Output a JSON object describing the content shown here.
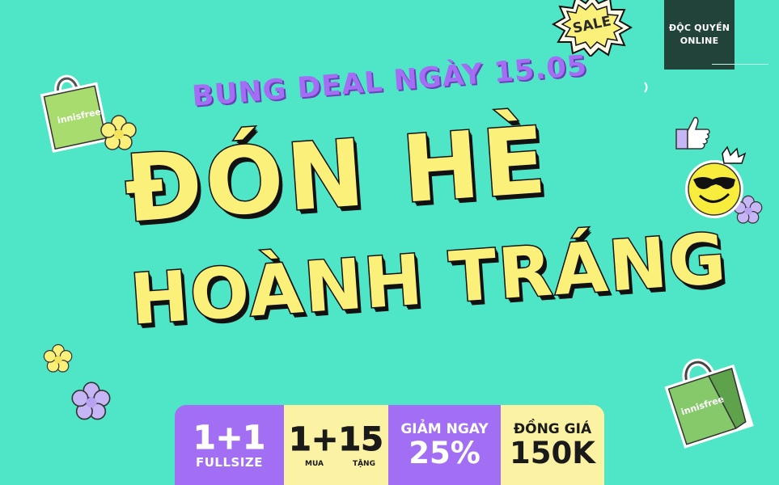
{
  "badge": {
    "line1": "ĐỘC QUYỀN",
    "line2": "ONLINE"
  },
  "subtitle": "BUNG DEAL NGÀY 15.05",
  "title": {
    "line1": "ĐÓN HÈ",
    "line2": "HOÀNH TRÁNG"
  },
  "deals": [
    {
      "big": "1+1",
      "small": "FULLSIZE"
    },
    {
      "big": "1+15",
      "left": "MUA",
      "right": "TẶNG"
    },
    {
      "top": "GIẢM NGAY",
      "big": "25%"
    },
    {
      "top": "ĐỒNG GIÁ",
      "big": "150K"
    }
  ],
  "stickers": {
    "sale": "SALE",
    "bag_brand": "innisfree"
  },
  "colors": {
    "background": "#4fe6c7",
    "purple": "#a26ff4",
    "yellow": "#fbf2a3",
    "title_yellow": "#fbf07a",
    "badge": "#21433a"
  }
}
